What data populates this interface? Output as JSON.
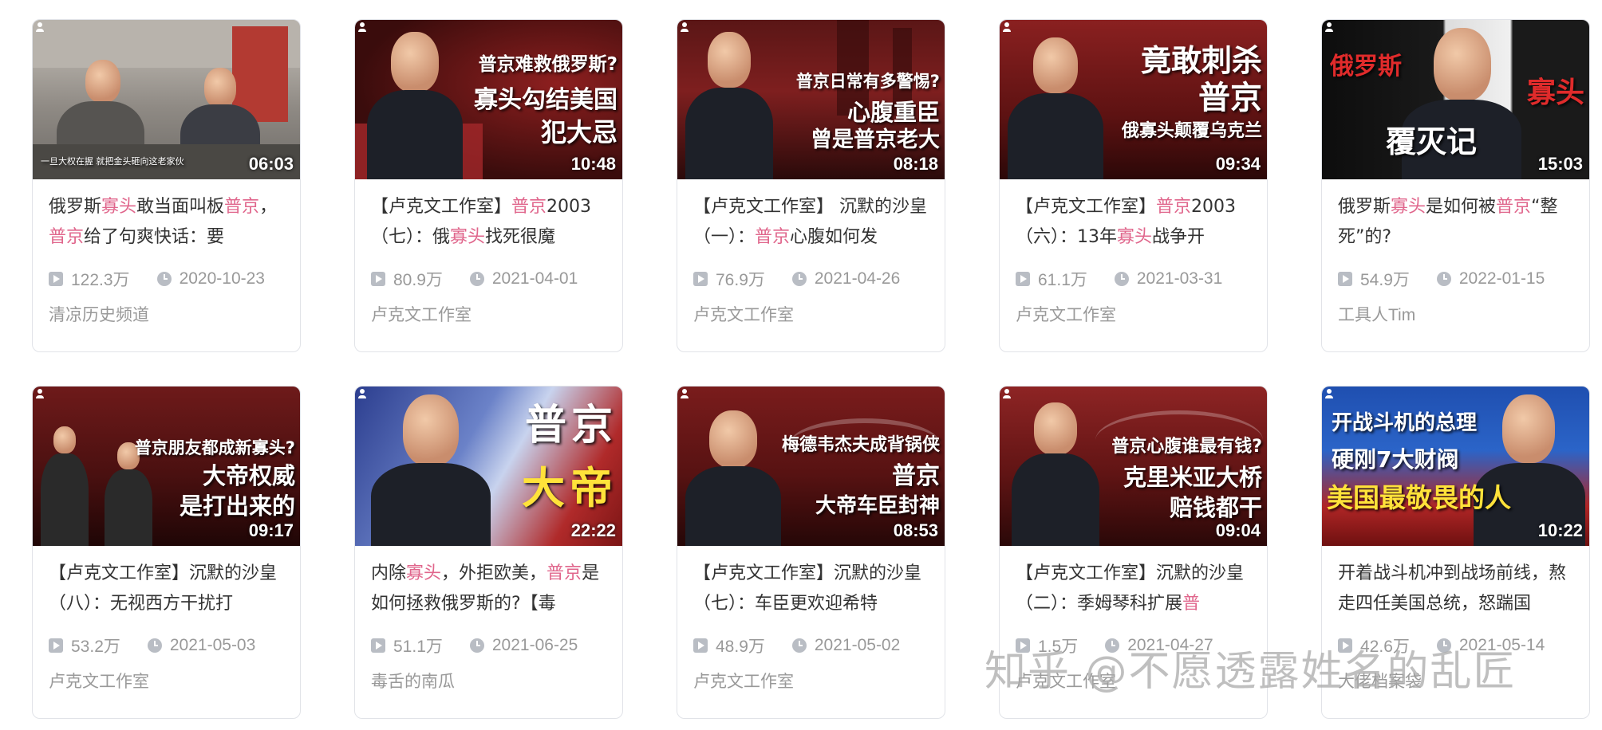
{
  "videos": [
    {
      "title_parts": [
        {
          "t": "俄罗斯"
        },
        {
          "t": "寡头",
          "hl": true
        },
        {
          "t": "敢当面叫板"
        },
        {
          "t": "普京",
          "hl": true
        },
        {
          "t": "，"
        },
        {
          "t": "普京",
          "hl": true
        },
        {
          "t": "给了句爽快话：要"
        }
      ],
      "views": "122.3万",
      "date": "2020-10-23",
      "author": "清凉历史频道",
      "duration": "06:03",
      "overlay": [
        "一旦大权在握 就把金头砸向这老家伙"
      ]
    },
    {
      "title_parts": [
        {
          "t": "【卢克文工作室】"
        },
        {
          "t": "普京",
          "hl": true
        },
        {
          "t": "2003（七）：俄"
        },
        {
          "t": "寡头",
          "hl": true
        },
        {
          "t": "找死很魔"
        }
      ],
      "views": "80.9万",
      "date": "2021-04-01",
      "author": "卢克文工作室",
      "duration": "10:48",
      "overlay": [
        "普京难救俄罗斯?",
        "寡头勾结美国",
        "犯大忌"
      ]
    },
    {
      "title_parts": [
        {
          "t": "【卢克文工作室】 沉默的沙皇（一）："
        },
        {
          "t": "普京",
          "hl": true
        },
        {
          "t": "心腹如何发"
        }
      ],
      "views": "76.9万",
      "date": "2021-04-26",
      "author": "卢克文工作室",
      "duration": "08:18",
      "overlay": [
        "普京日常有多警惕?",
        "心腹重臣",
        "曾是普京老大"
      ]
    },
    {
      "title_parts": [
        {
          "t": "【卢克文工作室】"
        },
        {
          "t": "普京",
          "hl": true
        },
        {
          "t": "2003（六）：13年"
        },
        {
          "t": "寡头",
          "hl": true
        },
        {
          "t": "战争开"
        }
      ],
      "views": "61.1万",
      "date": "2021-03-31",
      "author": "卢克文工作室",
      "duration": "09:34",
      "overlay": [
        "竟敢刺杀",
        "普京",
        "俄寡头颠覆乌克兰"
      ]
    },
    {
      "title_parts": [
        {
          "t": "俄罗斯"
        },
        {
          "t": "寡头",
          "hl": true
        },
        {
          "t": "是如何被"
        },
        {
          "t": "普京",
          "hl": true
        },
        {
          "t": "“整死”的?"
        }
      ],
      "views": "54.9万",
      "date": "2022-01-15",
      "author": "工具人Tim",
      "duration": "15:03",
      "overlay": [
        "俄罗斯",
        "寡头",
        "覆灭记"
      ]
    },
    {
      "title_parts": [
        {
          "t": "【卢克文工作室】沉默的沙皇（八）：无视西方干扰打"
        }
      ],
      "views": "53.2万",
      "date": "2021-05-03",
      "author": "卢克文工作室",
      "duration": "09:17",
      "overlay": [
        "普京朋友都成新寡头?",
        "大帝权威",
        "是打出来的"
      ]
    },
    {
      "title_parts": [
        {
          "t": "内除"
        },
        {
          "t": "寡头",
          "hl": true
        },
        {
          "t": "，外拒欧美，"
        },
        {
          "t": "普京",
          "hl": true
        },
        {
          "t": "是如何拯救俄罗斯的?【毒"
        }
      ],
      "views": "51.1万",
      "date": "2021-06-25",
      "author": "毒舌的南瓜",
      "duration": "22:22",
      "overlay": [
        "普京",
        "大帝"
      ]
    },
    {
      "title_parts": [
        {
          "t": "【卢克文工作室】沉默的沙皇（七）：车臣更欢迎希特"
        }
      ],
      "views": "48.9万",
      "date": "2021-05-02",
      "author": "卢克文工作室",
      "duration": "08:53",
      "overlay": [
        "梅德韦杰夫成背锅侠",
        "普京",
        "大帝车臣封神"
      ]
    },
    {
      "title_parts": [
        {
          "t": "【卢克文工作室】沉默的沙皇（二）：季姆琴科扩展"
        },
        {
          "t": "普",
          "hl": true
        }
      ],
      "views": "1.5万",
      "date": "2021-04-27",
      "author": "卢克文工作室",
      "duration": "09:04",
      "overlay": [
        "普京心腹谁最有钱?",
        "克里米亚大桥",
        "赔钱都干"
      ]
    },
    {
      "title_parts": [
        {
          "t": "开着战斗机冲到战场前线，熬走四任美国总统，怒踹国"
        }
      ],
      "views": "42.6万",
      "date": "2021-05-14",
      "author": "大佬档案袋",
      "duration": "10:22",
      "overlay": [
        "开战斗机的总理",
        "硬刚7大财阀",
        "美国最敬畏的人"
      ]
    }
  ],
  "watermark": "知乎 @不愿透露姓名的乱匠",
  "colors": {
    "highlight": "#e0668c",
    "meta_gray": "#999999",
    "border": "#e1e3e8"
  },
  "icons": {
    "views": "play-icon",
    "date": "clock-icon",
    "author": "user-icon"
  }
}
